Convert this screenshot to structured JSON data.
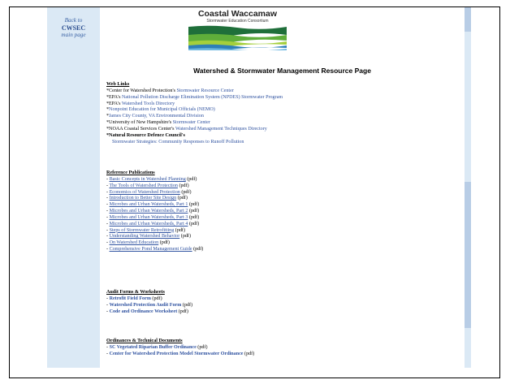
{
  "sidebar": {
    "back_line1": "Back to",
    "back_line2": "CWSEC",
    "back_line3": "main page"
  },
  "logo": {
    "title": "Coastal Waccamaw",
    "subtitle": "Stormwater Education Consortium",
    "colors": [
      "#1f6f3a",
      "#5fae3a",
      "#a4cf3c",
      "#2e7fb8",
      "#6cb7e0"
    ]
  },
  "page_title": "Watershed & Stormwater Management Resource Page",
  "web_links": {
    "heading": "Web Links",
    "items": [
      {
        "pre": "*Center for Watershed Protection's ",
        "link": "Stormwater Resource Center",
        "suf": ""
      },
      {
        "pre": "*EPA's ",
        "link": "National Pollution Discharge Elimination System (NPDES) Stormwater Program",
        "suf": ""
      },
      {
        "pre": "*EPA's ",
        "link": "Watershed Tools Directory",
        "suf": ""
      },
      {
        "pre": "*",
        "link": "Nonpoint Education for Municipal Officials (NEMO)",
        "suf": ""
      },
      {
        "pre": "*",
        "link": "James City County, VA Environmental Division",
        "suf": ""
      },
      {
        "pre": "*University of New Hampshire's ",
        "link": "Stormwater Center",
        "suf": ""
      },
      {
        "pre": "*NOAA Coastal Services Center's ",
        "link": "Watershed Management Techniques Directory",
        "suf": ""
      },
      {
        "pre": "*Natural Resource Defence Council's",
        "link": "",
        "suf": ""
      },
      {
        "pre": "",
        "link": "Stormwater Strategies: Community Responses to Runoff Pollution",
        "suf": ""
      }
    ]
  },
  "reference_publications": {
    "heading": "Reference Publications",
    "items": [
      {
        "pre": "- ",
        "link": "Basic Concepts in Watershed Planning",
        "suf": " (pdf)"
      },
      {
        "pre": "- ",
        "link": "The Tools of Watershed Protection",
        "suf": " (pdf)"
      },
      {
        "pre": "- ",
        "link": "Economics of Watershed Protection",
        "suf": " (pdf)"
      },
      {
        "pre": "- ",
        "link": "Introduction to Better Site Design",
        "suf": " (pdf)"
      },
      {
        "pre": "- ",
        "link": "Microbes and Urban Watersheds, Part 1",
        "suf": " (pdf)"
      },
      {
        "pre": "- ",
        "link": "Microbes and Urban Watersheds, Part 2",
        "suf": " (pdf)"
      },
      {
        "pre": "- ",
        "link": "Microbes and Urban Watersheds, Part 3",
        "suf": " (pdf)"
      },
      {
        "pre": "- ",
        "link": "Microbes and Urban Watersheds, Part 4",
        "suf": " (pdf)"
      },
      {
        "pre": "- ",
        "link": "Steps of Stormwater Retrofitting",
        "suf": " (pdf)"
      },
      {
        "pre": "- ",
        "link": "Understanding Watershed Behavior",
        "suf": " (pdf)"
      },
      {
        "pre": "- ",
        "link": "On Watershed Education",
        "suf": " (pdf)"
      },
      {
        "pre": "- ",
        "link": "Comprehensive Pond Management Guide",
        "suf": " (pdf)"
      }
    ]
  },
  "audit_forms": {
    "heading": "Audit Forms & Worksheets",
    "items": [
      {
        "pre": "- ",
        "link": "Retrofit Field Form",
        "suf": " (pdf)"
      },
      {
        "pre": "- ",
        "link": "Watershed Protection Audit Form",
        "suf": " (pdf)"
      },
      {
        "pre": "- ",
        "link": "Code and Ordinance Worksheet",
        "suf": " (pdf)"
      }
    ]
  },
  "ordinances": {
    "heading": "Ordinances & Technical Documents",
    "items": [
      {
        "pre": "- ",
        "link": "SC Vegetated Riparian Buffer Ordinance",
        "suf": " (pdf)"
      },
      {
        "pre": "- ",
        "link": "Center for Watershed Protection Model Stormwater Ordinance",
        "suf": " (pdf)"
      }
    ]
  }
}
